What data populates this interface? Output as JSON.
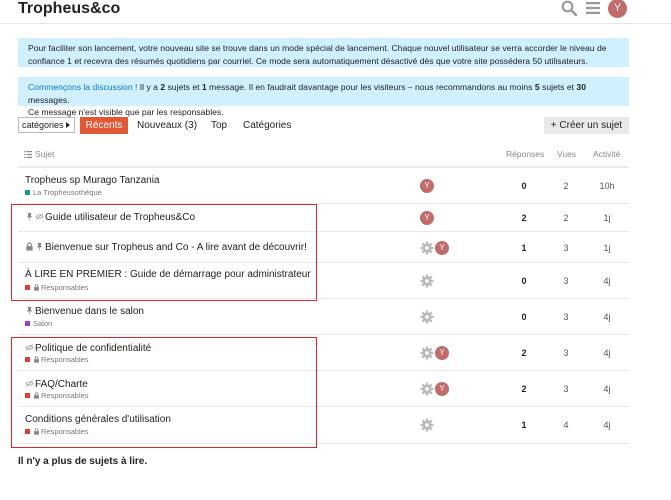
{
  "header": {
    "site_title": "Tropheus&co",
    "avatar_letter": "Y"
  },
  "notices": {
    "launch": "Pour faciliter son lancement, votre nouveau site se trouve dans un mode spécial de lancement. Chaque nouvel utilisateur se verra accorder le niveau de confiance 1 et recevra des résumés quotidiens par courriel. Ce mode sera automatiquement désactivé dès que votre site possédera 50 utilisateurs.",
    "discussion_link": "Commençons la discussion !",
    "discussion_pre": " Il y a ",
    "discussion_topics": "2",
    "discussion_mid1": " sujets et ",
    "discussion_msgs": "1",
    "discussion_mid2": " message. Il en faudrait davantage pour les visiteurs – nous recommandons au moins ",
    "discussion_min_topics": "5",
    "discussion_mid3": " sujets et ",
    "discussion_min_msgs": "30",
    "discussion_end": " messages.",
    "discussion_staff": "Ce message n'est visible que par les responsables."
  },
  "nav": {
    "categories_dropdown": "catégories",
    "tab_recent": "Récents",
    "tab_new": "Nouveaux (3)",
    "tab_top": "Top",
    "tab_categories": "Catégories",
    "create_topic": "+ Créer un sujet"
  },
  "list_header": {
    "topic": "Sujet",
    "replies": "Réponses",
    "views": "Vues",
    "activity": "Activité"
  },
  "topics": [
    {
      "title": "Tropheus sp Murago Tanzania",
      "category": "La Tropheusothèque",
      "category_color": "#0e9a8f",
      "replies": "0",
      "views": "2",
      "activity": "10h"
    },
    {
      "title": "Guide utilisateur de Tropheus&Co",
      "category": "",
      "category_color": "",
      "replies": "2",
      "views": "2",
      "activity": "1j"
    },
    {
      "title": "Bienvenue sur Tropheus and Co - A lire avant de découvrir!",
      "category": "",
      "category_color": "",
      "replies": "1",
      "views": "3",
      "activity": "1j"
    },
    {
      "title": "À LIRE EN PREMIER : Guide de démarrage pour administrateur",
      "category": "Responsables",
      "category_color": "#e03d33",
      "replies": "0",
      "views": "3",
      "activity": "4j"
    },
    {
      "title": "Bienvenue dans le salon",
      "category": "Salon",
      "category_color": "#9b3fc9",
      "replies": "0",
      "views": "3",
      "activity": "4j"
    },
    {
      "title": "Politique de confidentialité",
      "category": "Responsables",
      "category_color": "#e03d33",
      "replies": "2",
      "views": "3",
      "activity": "4j"
    },
    {
      "title": "FAQ/Charte",
      "category": "Responsables",
      "category_color": "#e03d33",
      "replies": "2",
      "views": "3",
      "activity": "4j"
    },
    {
      "title": "Conditions générales d'utilisation",
      "category": "Responsables",
      "category_color": "#e03d33",
      "replies": "1",
      "views": "4",
      "activity": "4j"
    }
  ],
  "footer": {
    "no_more": "Il n'y a plus de sujets à lire."
  },
  "colors": {
    "accent": "#e45735",
    "notice_bg": "#d1f0ff",
    "highlight_box": "#d9272e",
    "avatar": "#c16b6b"
  },
  "icons": [
    "search-icon",
    "hamburger-menu-icon",
    "avatar",
    "list-icon",
    "pin-icon",
    "unlisted-icon",
    "lock-icon",
    "gear-icon"
  ]
}
